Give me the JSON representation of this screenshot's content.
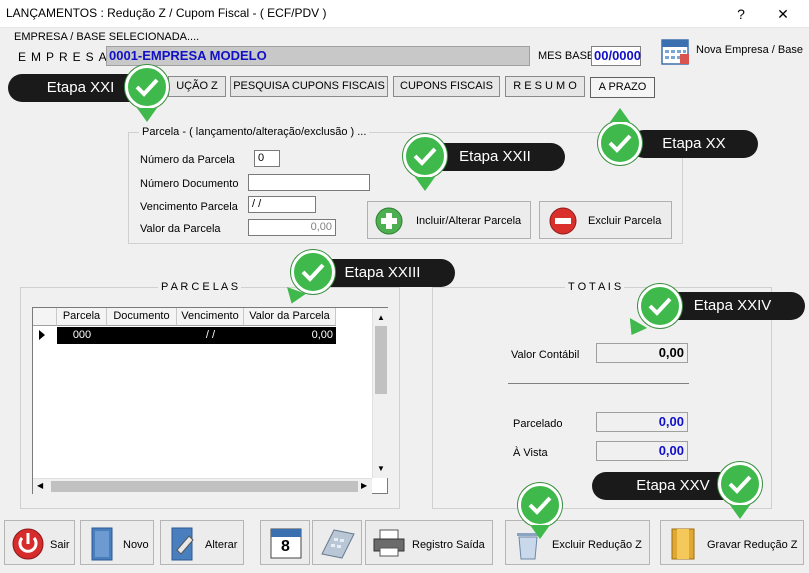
{
  "window": {
    "title": "LANÇAMENTOS : Redução Z / Cupom Fiscal - ( ECF/PDV )",
    "help": "?",
    "close": "✕"
  },
  "header": {
    "label": "EMPRESA  /  BASE  SELECIONADA....",
    "empresa_label": "EMPRESA",
    "empresa_value": "0001-EMPRESA MODELO",
    "mes_label": "MES BASE",
    "mes_value": "00/0000",
    "nova_empresa": "Nova Empresa / Base"
  },
  "tabs": [
    {
      "label": "UÇÃO Z"
    },
    {
      "label": "PESQUISA CUPONS FISCAIS"
    },
    {
      "label": "CUPONS FISCAIS"
    },
    {
      "label": "R E S U M O"
    },
    {
      "label": "A PRAZO"
    }
  ],
  "parcela_form": {
    "title": "Parcela - ( lançamento/alteração/exclusão ) ...",
    "numero_label": "Número da Parcela",
    "numero_value": "0",
    "documento_label": "Número  Documento",
    "documento_value": "",
    "vencimento_label": "Vencimento Parcela",
    "vencimento_value": " / /",
    "valor_label": "Valor da Parcela",
    "valor_value": "0,00",
    "incluir_label": "Incluir/Alterar Parcela",
    "excluir_label": "Excluir Parcela"
  },
  "parcelas": {
    "title": "P A R C E L A S",
    "columns": [
      "Parcela",
      "Documento",
      "Vencimento",
      "Valor da Parcela"
    ],
    "rows": [
      {
        "parcela": "000",
        "documento": "",
        "vencimento": " / /",
        "valor": "0,00"
      }
    ]
  },
  "totais": {
    "title": "T O T A I S",
    "valor_contabil_label": "Valor Contábil",
    "valor_contabil": "0,00",
    "parcelado_label": "Parcelado",
    "parcelado": "0,00",
    "avista_label": "À Vista",
    "avista": "0,00"
  },
  "toolbar": {
    "sair": "Sair",
    "novo": "Novo",
    "alterar": "Alterar",
    "calendar_day": "8",
    "registro_saida": "Registro Saída",
    "excluir_reducao": "Excluir Redução Z",
    "gravar_reducao": "Gravar Redução Z"
  },
  "etapas": {
    "xxi": "Etapa XXI",
    "xx": "Etapa XX",
    "xxii": "Etapa XXII",
    "xxiii": "Etapa XXIII",
    "xxiv": "Etapa XXIV",
    "xxv": "Etapa XXV"
  },
  "colors": {
    "accent_blue": "#1010c8",
    "check_green": "#3fb94b",
    "callout_black": "#1a1a1a"
  }
}
